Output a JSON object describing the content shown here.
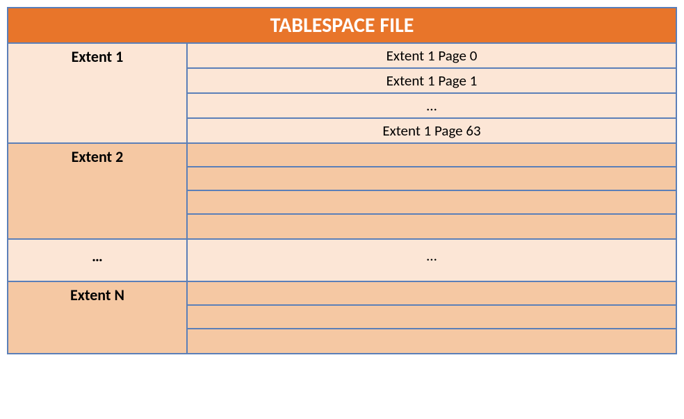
{
  "header": {
    "title": "TABLESPACE FILE"
  },
  "extents": {
    "extent1": {
      "label": "Extent 1",
      "pages": [
        "Extent 1 Page 0",
        "Extent 1 Page 1",
        "…",
        "Extent 1 Page 63"
      ]
    },
    "extent2": {
      "label": "Extent 2",
      "pages": [
        "",
        "",
        "",
        ""
      ]
    },
    "ellipsis": {
      "left": "…",
      "right": "…"
    },
    "extentN": {
      "label": "Extent N",
      "pages": [
        "",
        "",
        ""
      ]
    }
  }
}
